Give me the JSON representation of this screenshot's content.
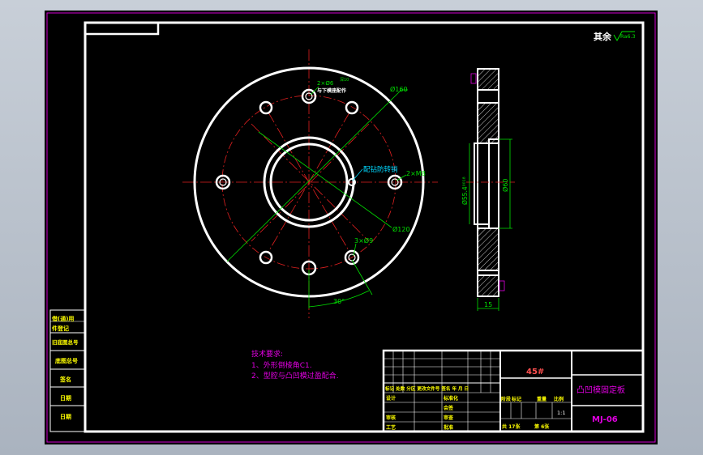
{
  "colors": {
    "background": "#000000",
    "frame": "#ffffff",
    "outer_border": "#d400d4",
    "centerline": "#e02020",
    "dimension": "#00e000",
    "annotation": "#e000e0",
    "leader": "#00d8ff",
    "title_text": "#ffff00"
  },
  "roughness": {
    "label": "其余",
    "value": "Ra6.3"
  },
  "front_view": {
    "dia_160": "Ø160",
    "dia_120": "Ø120",
    "holes_small": "2×Ø6",
    "holes_small_depth": "深10",
    "holes_small_note": "与下模座配作",
    "pin_label": "配钻防转销",
    "thread": "2×M8",
    "holes_large": "3×Ø9",
    "angle": "30°"
  },
  "side_view": {
    "dia_55": "Ø55.4⁰⁰¹⁸",
    "dia_60": "Ø60",
    "thickness": "15"
  },
  "tech_requirements": {
    "title": "技术要求:",
    "items": [
      "1、外形倒棱角C1.",
      "2、型腔与凸凹模过盈配合."
    ]
  },
  "left_strip": [
    "借(通)用",
    "件登记",
    "旧底图总号",
    "底图总号",
    "签名",
    "日期",
    "日期"
  ],
  "title_block": {
    "material": "45#",
    "part_name": "凸凹模固定板",
    "drawing_no": "MJ-06",
    "scale": "1:1",
    "revision_header": "标记 处数 分区 更改文件号 签名 年 月 日",
    "design": "设计",
    "standardize": "标准化",
    "review": "审核",
    "process": "工艺",
    "approve": "批准",
    "stage_labels": [
      "阶段",
      "标记",
      "重量",
      "比例"
    ],
    "sheets_total": "共 17张",
    "sheet_no": "第 6张",
    "inspection": "审查",
    "count": "会签"
  }
}
